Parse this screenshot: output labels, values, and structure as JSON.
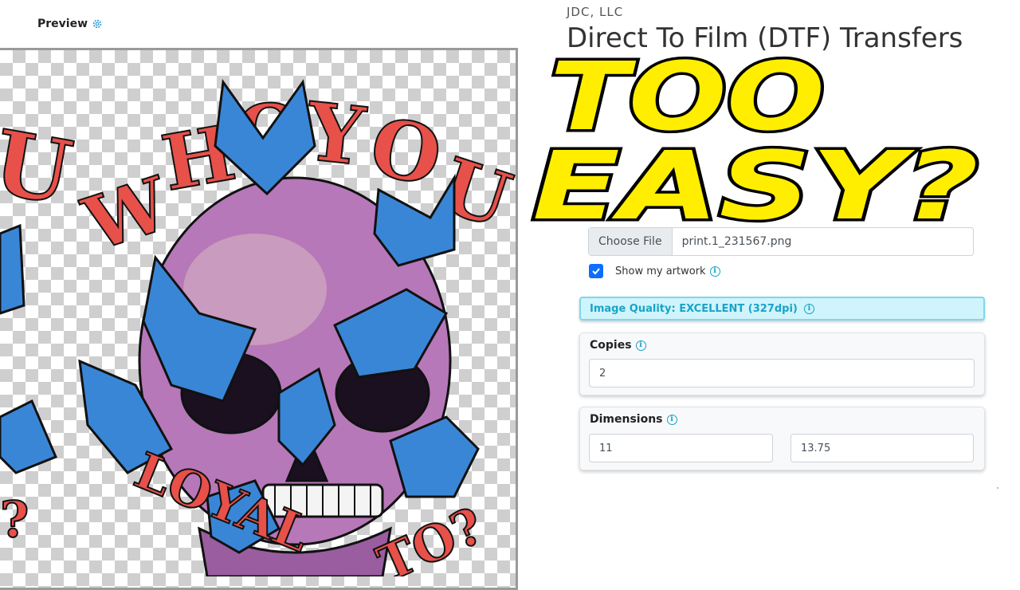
{
  "preview": {
    "label": "Preview",
    "gear_icon": "gear-icon"
  },
  "artwork": {
    "top_text": "U WHO YOU",
    "top_letters": [
      "U",
      "W",
      "H",
      "O",
      "Y",
      "O",
      "U"
    ],
    "bottom_text_left": "LOYAL",
    "bottom_text_right": "TO?",
    "left_edge_text": "?",
    "colors": {
      "text": "#e8504a",
      "skull": "#b678b8",
      "butterfly": "#3a86d6",
      "outline": "#111111"
    }
  },
  "header": {
    "company": "JDC, LLC",
    "title": "Direct To Film (DTF) Transfers"
  },
  "overlay": {
    "line1": "TOO",
    "line2": "EASY?",
    "fill": "#ffee00",
    "stroke": "#000000"
  },
  "upload": {
    "button_label": "Choose File",
    "file_name": "print.1_231567.png"
  },
  "show_artwork": {
    "label": "Show my artwork",
    "checked": true
  },
  "quality": {
    "text": "Image Quality: EXCELLENT (327dpi)"
  },
  "copies": {
    "label": "Copies",
    "value": "2"
  },
  "dimensions": {
    "label": "Dimensions",
    "width": "11",
    "height": "13.75"
  },
  "colors": {
    "accent": "#0d6efd",
    "info": "#1aa3c8",
    "info_bg": "#cff4fc"
  }
}
